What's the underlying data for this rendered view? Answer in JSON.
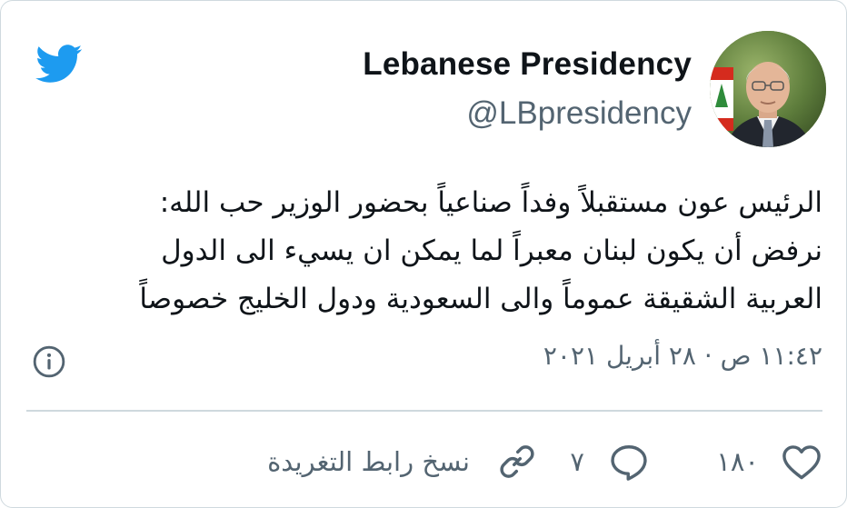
{
  "header": {
    "display_name": "Lebanese Presidency",
    "handle": "@LBpresidency"
  },
  "icons": {
    "logo": "twitter-bird-icon",
    "info": "info-icon",
    "like": "heart-icon",
    "reply": "speech-bubble-icon",
    "copy_link": "link-icon"
  },
  "tweet": {
    "lines": [
      "الرئيس عون مستقبلاً وفداً صناعياً بحضور الوزير حب الله:",
      "نرفض أن يكون لبنان معبراً لما يمكن ان يسيء الى الدول",
      "العربية الشقيقة عموماً والى السعودية ودول الخليج خصوصاً"
    ],
    "timestamp": "١١:٤٢ ص · ٢٨ أبريل ٢٠٢١"
  },
  "actions": {
    "likes": "١٨٠",
    "replies": "٧",
    "copy_link_label": "نسخ رابط التغريدة"
  },
  "colors": {
    "twitter_blue": "#1d9bf0",
    "text_primary": "#0f1419",
    "text_secondary": "#536471",
    "border": "#cfd9de"
  }
}
